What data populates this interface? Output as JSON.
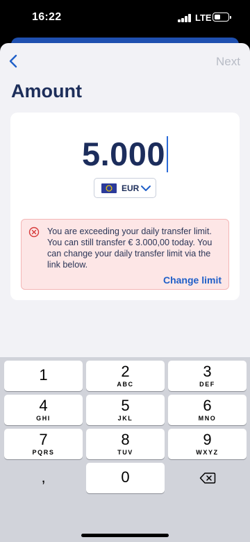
{
  "status_bar": {
    "time": "16:22",
    "network": "LTE"
  },
  "header": {
    "back_icon": "chevron-left-icon",
    "next_label": "Next"
  },
  "page_title": "Amount",
  "amount": {
    "value": "5.000"
  },
  "currency": {
    "code": "EUR",
    "flag_icon": "eu-flag-icon"
  },
  "alert": {
    "message": "You are exceeding your daily transfer limit. You can still transfer € 3.000,00 today. You can change your daily transfer limit via the link below.",
    "link_label": "Change limit",
    "icon": "error-circle-icon"
  },
  "keypad": {
    "keys": [
      {
        "digit": "1",
        "letters": ""
      },
      {
        "digit": "2",
        "letters": "ABC"
      },
      {
        "digit": "3",
        "letters": "DEF"
      },
      {
        "digit": "4",
        "letters": "GHI"
      },
      {
        "digit": "5",
        "letters": "JKL"
      },
      {
        "digit": "6",
        "letters": "MNO"
      },
      {
        "digit": "7",
        "letters": "PQRS"
      },
      {
        "digit": "8",
        "letters": "TUV"
      },
      {
        "digit": "9",
        "letters": "WXYZ"
      },
      {
        "digit": ",",
        "letters": ""
      },
      {
        "digit": "0",
        "letters": ""
      }
    ],
    "delete_icon": "backspace-icon"
  },
  "colors": {
    "accent": "#1f5fc8",
    "title": "#1d2e5a",
    "alert_bg": "#fde6e6",
    "alert_border": "#f4b6b6",
    "error": "#d63a3a"
  }
}
